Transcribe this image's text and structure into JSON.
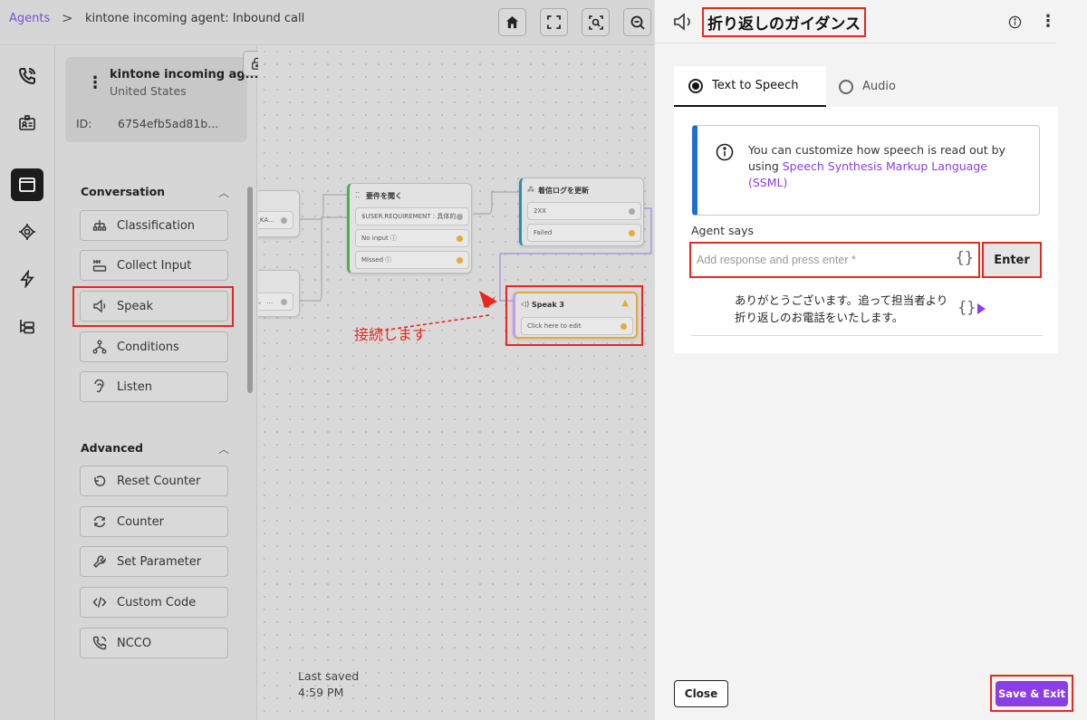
{
  "breadcrumb": {
    "root": "Agents",
    "separator": ">",
    "page": "kintone incoming agent: Inbound call"
  },
  "agent": {
    "name": "kintone incoming ag...",
    "country": "United States",
    "id_label": "ID:",
    "id_value": "6754efb5ad81b..."
  },
  "palette": {
    "conversation_title": "Conversation",
    "conversation_items": [
      {
        "label": "Classification",
        "icon": "classification-icon"
      },
      {
        "label": "Collect Input",
        "icon": "collect-input-icon"
      },
      {
        "label": "Speak",
        "icon": "speaker-icon"
      },
      {
        "label": "Conditions",
        "icon": "conditions-icon"
      },
      {
        "label": "Listen",
        "icon": "listen-icon"
      }
    ],
    "advanced_title": "Advanced",
    "advanced_items": [
      {
        "label": "Reset Counter",
        "icon": "reset-icon"
      },
      {
        "label": "Counter",
        "icon": "counter-icon"
      },
      {
        "label": "Set Parameter",
        "icon": "wrench-icon"
      },
      {
        "label": "Custom Code",
        "icon": "code-icon"
      },
      {
        "label": "NCCO",
        "icon": "phone-icon"
      }
    ]
  },
  "canvas": {
    "node_collect": {
      "title": "要件を聞く",
      "rows": [
        "$USER.REQUIREMENT : 具体的... ",
        "No input ⓘ",
        "Missed ⓘ"
      ]
    },
    "node_log": {
      "title": "着信ログを更新",
      "rows": [
        "2XX",
        "Failed"
      ]
    },
    "node_speak": {
      "title": "Speak 3",
      "row": "Click here to edit"
    },
    "partial_node_1": "E_KA...",
    "partial_node_2": "す。 ...",
    "annotation": "接続します",
    "last_saved_label": "Last saved",
    "last_saved_time": "4:59 PM"
  },
  "panel": {
    "title": "折り返しのガイダンス",
    "tabs": [
      {
        "label": "Text to Speech",
        "selected": true
      },
      {
        "label": "Audio",
        "selected": false
      }
    ],
    "notice_text": "You can customize how speech is read out by using ",
    "notice_link": "Speech Synthesis Markup Language (SSML)",
    "agent_says_label": "Agent says",
    "input_placeholder": "Add response and press enter *",
    "input_value": "",
    "enter_label": "Enter",
    "saved_response": "ありがとうございます。追って担当者より折り返しのお電話をいたします。",
    "braces": "{}",
    "close_label": "Close",
    "save_exit_label": "Save & Exit"
  },
  "colors": {
    "accent": "#8b3ee5",
    "info_border": "#1f6fd0",
    "highlight": "#e8281e",
    "warning": "#e6a93a"
  }
}
